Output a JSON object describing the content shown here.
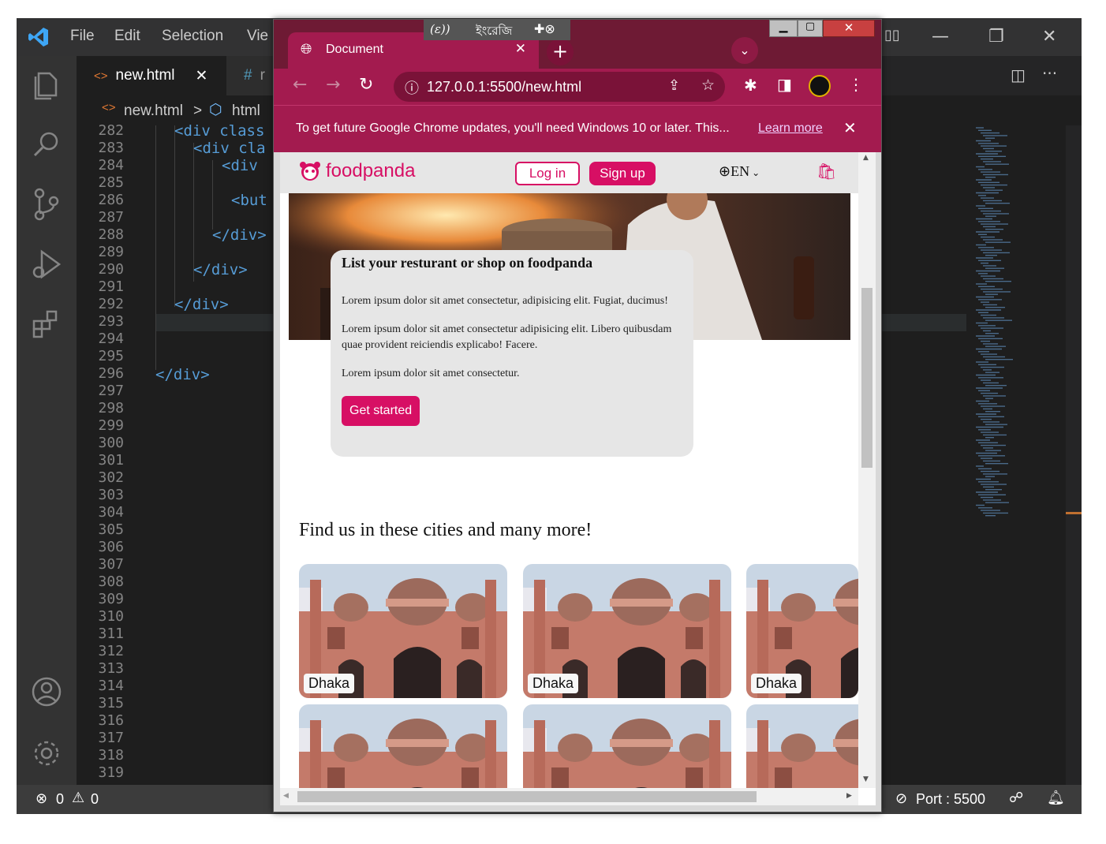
{
  "vscode": {
    "menu": [
      "File",
      "Edit",
      "Selection",
      "Vie"
    ],
    "tabs": [
      {
        "label": "new.html",
        "close": "✕"
      },
      {
        "label": "r",
        "icon": "#"
      }
    ],
    "breadcrumb": {
      "file": "new.html",
      "sep": ">",
      "node": "html"
    },
    "line_numbers": [
      "282",
      "283",
      "284",
      "285",
      "286",
      "287",
      "288",
      "289",
      "290",
      "291",
      "292",
      "293",
      "294",
      "295",
      "296",
      "297",
      "298",
      "299",
      "300",
      "301",
      "302",
      "303",
      "304",
      "305",
      "306",
      "307",
      "308",
      "309",
      "310",
      "311",
      "312",
      "313",
      "314",
      "315",
      "316",
      "317",
      "318",
      "319"
    ],
    "code_lines": {
      "l282": "<div class",
      "l283": "<div cla",
      "l284": "<div",
      "l286": "<but",
      "l288": "</div>",
      "l290": "</div>",
      "l292": "</div>",
      "l296": "</div>"
    },
    "status": {
      "errors": "0",
      "warnings": "0",
      "port": "Port : 5500"
    }
  },
  "chrome": {
    "tab_title": "Document",
    "url": "127.0.0.1:5500/new.html",
    "ime_text": "ইংরেজি",
    "info_bar": {
      "text": "To get future Google Chrome updates, you'll need Windows 10 or later. This...",
      "link": "Learn more"
    }
  },
  "page": {
    "brand": "foodpanda",
    "login": "Log in",
    "signup": "Sign up",
    "language": "EN",
    "card": {
      "title": "List your resturant or shop on foodpanda",
      "p1": "Lorem ipsum dolor sit amet consectetur, adipisicing elit. Fugiat, ducimus!",
      "p2": "Lorem ipsum dolor sit amet consectetur adipisicing elit. Libero quibusdam quae provident reiciendis explicabo! Facere.",
      "p3": "Lorem ipsum dolor sit amet consectetur.",
      "cta": "Get started"
    },
    "cities_heading": "Find us in these cities and many more!",
    "cities": [
      "Dhaka",
      "Dhaka",
      "Dhaka"
    ]
  },
  "colors": {
    "brand": "#d70f64",
    "chrome_frame": "#a31b4f",
    "vscode_bg": "#1e1e1e"
  }
}
